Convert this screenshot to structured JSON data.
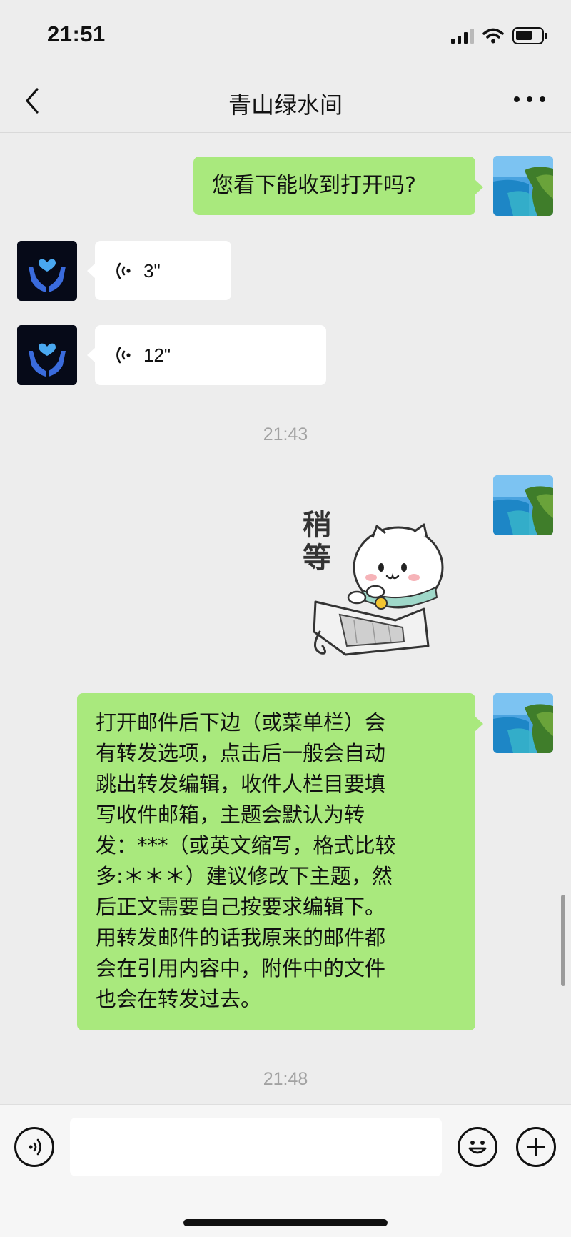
{
  "status_bar": {
    "time": "21:51",
    "signal_bars": 4,
    "signal_active": 3,
    "battery_level": 0.55
  },
  "nav": {
    "title": "青山绿水间"
  },
  "messages": [
    {
      "type": "text",
      "sender": "self",
      "text": "您看下能收到打开吗?"
    },
    {
      "type": "voice",
      "sender": "other",
      "duration": "3\""
    },
    {
      "type": "voice",
      "sender": "other",
      "duration": "12\""
    },
    {
      "type": "timestamp",
      "text": "21:43"
    },
    {
      "type": "sticker",
      "sender": "self",
      "text": "稍等",
      "sticker_label": "cat-typing-sticker"
    },
    {
      "type": "text",
      "sender": "self",
      "lines": [
        "打开邮件后下边（或菜单栏）会",
        "有转发选项，点击后一般会自动",
        "跳出转发编辑，收件人栏目要填",
        "写收件邮箱，主题会默认为转",
        "发：***（或英文缩写，格式比较",
        "多:＊＊＊）建议修改下主题，然",
        "后正文需要自己按要求编辑下。",
        "用转发邮件的话我原来的邮件都",
        "会在引用内容中，附件中的文件",
        "也会在转发过去。"
      ]
    },
    {
      "type": "timestamp",
      "text": "21:48"
    }
  ],
  "input_bar": {
    "voice_icon": "voice-toggle-icon",
    "emoji_icon": "emoji-icon",
    "plus_icon": "plus-icon",
    "text_value": ""
  },
  "colors": {
    "background": "#ededed",
    "self_bubble": "#a9e97d",
    "other_bubble": "#ffffff",
    "timestamp": "#a2a2a2"
  }
}
